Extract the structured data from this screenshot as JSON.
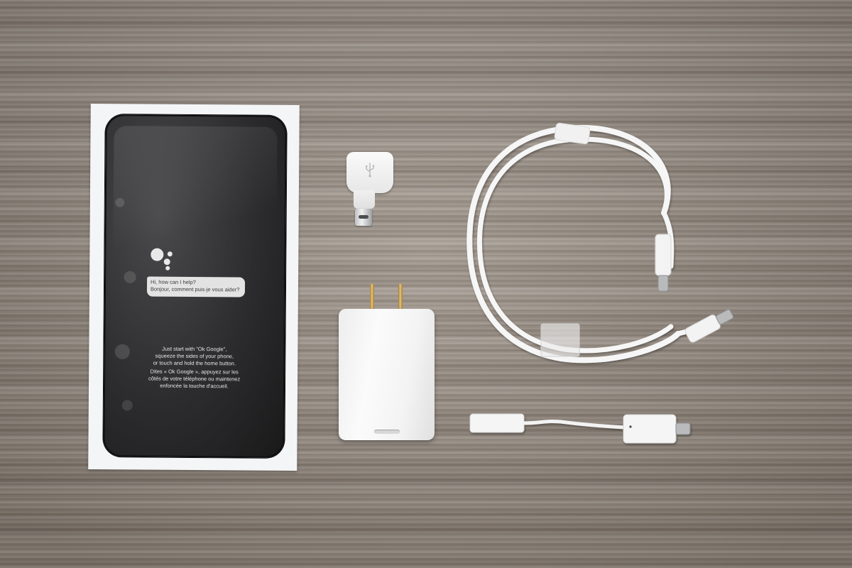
{
  "scene": {
    "surface": "wood-grain-desk",
    "items": [
      "phone-box",
      "usb-otg-adapter",
      "wall-charger",
      "usb-c-cable",
      "usb-c-headphone-adapter"
    ]
  },
  "phone_screen": {
    "assistant_bubble": {
      "line1": "Hi, how can I help?",
      "line2": "Bonjour, comment puis-je vous aider?"
    },
    "instructions": {
      "en_line1": "Just start with \"Ok Google\",",
      "en_line2": "squeeze the sides of your phone,",
      "en_line3": "or touch and hold the home button.",
      "fr_line1": "Dites « Ok Google », appuyez sur les",
      "fr_line2": "côtés de votre téléphone ou maintenez",
      "fr_line3": "enfoncée la touche d'accueil."
    }
  },
  "colors": {
    "desk": "#a1978c",
    "box": "#f4f5f7",
    "phone_body": "#2c2c2e",
    "accessory_white": "#f5f5f5",
    "prong_gold": "#d9b46a"
  },
  "icons": [
    "google-assistant-icon",
    "usb-symbol-icon"
  ]
}
